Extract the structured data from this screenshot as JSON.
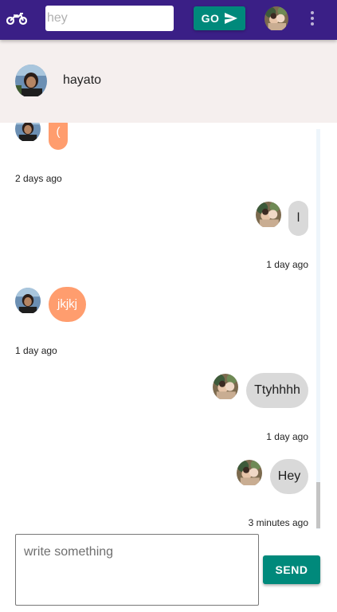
{
  "topbar": {
    "logo_icon": "motorcycle-icon",
    "search": {
      "value": "",
      "placeholder": "hey"
    },
    "go_label": "GO",
    "go_icon": "send-arrow-icon",
    "more_icon": "more-vert-icon"
  },
  "conversation": {
    "name": "hayato"
  },
  "messages": [
    {
      "direction": "incoming",
      "text": "(",
      "timestamp": "2 days ago"
    },
    {
      "direction": "outgoing",
      "text": "l",
      "timestamp": "1 day ago"
    },
    {
      "direction": "incoming",
      "text": "jkjkj",
      "timestamp": "1 day ago"
    },
    {
      "direction": "outgoing",
      "text": "Ttyhhhh",
      "timestamp": "1 day ago"
    },
    {
      "direction": "outgoing",
      "text": "Hey",
      "timestamp": "3 minutes ago"
    }
  ],
  "composer": {
    "placeholder": "write something",
    "value": "",
    "send_label": "SEND"
  },
  "colors": {
    "app_bar": "#3a1f86",
    "accent_button": "#00897b",
    "incoming_bubble": "#ff9d6e",
    "outgoing_bubble": "#d9d9d9",
    "header_background": "#f5efee"
  }
}
